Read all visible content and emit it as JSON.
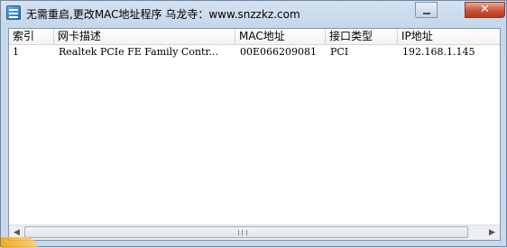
{
  "window": {
    "title": "无需重启,更改MAC地址程序 乌龙寺：www.snzzkz.com",
    "close_glyph": "✕"
  },
  "table": {
    "columns": [
      "索引",
      "网卡描述",
      "MAC地址",
      "接口类型",
      "IP地址"
    ],
    "rows": [
      [
        "1",
        "Realtek PCIe FE Family Contr...",
        "00E066209081",
        "PCI",
        "192.168.1.145"
      ]
    ]
  },
  "scrollbar": {
    "left_arrow": "◀",
    "right_arrow": "▶"
  },
  "colors": {
    "close_button": "#c7533a",
    "title_bar": "#d4e2f1",
    "border": "#6f87a5"
  }
}
